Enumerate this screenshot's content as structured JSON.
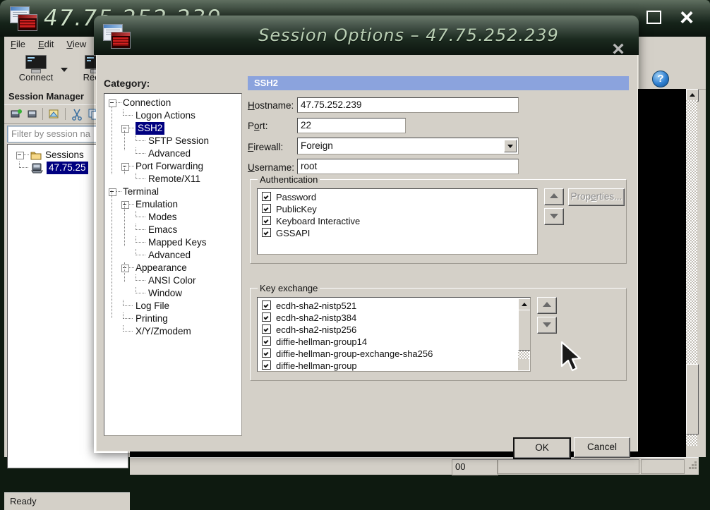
{
  "main_window": {
    "title": "47.75.252.239",
    "maximize_label": "□",
    "close_label": "×",
    "menu": [
      {
        "label": "File",
        "accel": "F"
      },
      {
        "label": "Edit",
        "accel": "E"
      },
      {
        "label": "View",
        "accel": "V"
      }
    ],
    "toolbar": {
      "connect_label": "Connect",
      "record_label": "Recor",
      "help_label": "Help",
      "help_glyph": "?"
    },
    "session_manager": {
      "title": "Session Manager",
      "filter_placeholder": "Filter by session na",
      "tree": {
        "root_label": "Sessions",
        "selected_session": "47.75.25"
      }
    },
    "status_bar": {
      "text": "Ready"
    },
    "bottom_strip": {
      "value": "00"
    }
  },
  "dialog": {
    "title": "Session Options – 47.75.252.239",
    "close_label": "×",
    "category_label": "Category:",
    "category_tree": [
      {
        "label": "Connection",
        "level": 0,
        "expander": true,
        "selected": false
      },
      {
        "label": "Logon Actions",
        "level": 1,
        "expander": false,
        "selected": false
      },
      {
        "label": "SSH2",
        "level": 1,
        "expander": true,
        "selected": true
      },
      {
        "label": "SFTP Session",
        "level": 2,
        "expander": false,
        "selected": false
      },
      {
        "label": "Advanced",
        "level": 2,
        "expander": false,
        "selected": false
      },
      {
        "label": "Port Forwarding",
        "level": 1,
        "expander": true,
        "selected": false
      },
      {
        "label": "Remote/X11",
        "level": 2,
        "expander": false,
        "selected": false
      },
      {
        "label": "Terminal",
        "level": 0,
        "expander": true,
        "selected": false
      },
      {
        "label": "Emulation",
        "level": 1,
        "expander": true,
        "selected": false
      },
      {
        "label": "Modes",
        "level": 2,
        "expander": false,
        "selected": false
      },
      {
        "label": "Emacs",
        "level": 2,
        "expander": false,
        "selected": false
      },
      {
        "label": "Mapped Keys",
        "level": 2,
        "expander": false,
        "selected": false
      },
      {
        "label": "Advanced",
        "level": 2,
        "expander": false,
        "selected": false
      },
      {
        "label": "Appearance",
        "level": 1,
        "expander": true,
        "selected": false
      },
      {
        "label": "ANSI Color",
        "level": 2,
        "expander": false,
        "selected": false
      },
      {
        "label": "Window",
        "level": 2,
        "expander": false,
        "selected": false
      },
      {
        "label": "Log File",
        "level": 1,
        "expander": false,
        "selected": false
      },
      {
        "label": "Printing",
        "level": 1,
        "expander": false,
        "selected": false
      },
      {
        "label": "X/Y/Zmodem",
        "level": 1,
        "expander": false,
        "selected": false
      }
    ],
    "panel": {
      "header": "SSH2",
      "fields": {
        "hostname": {
          "label_pre": "",
          "label_accel": "H",
          "label_post": "ostname:",
          "value": "47.75.252.239"
        },
        "port": {
          "label_pre": "P",
          "label_accel": "o",
          "label_post": "rt:",
          "value": "22"
        },
        "firewall": {
          "label_pre": "",
          "label_accel": "F",
          "label_post": "irewall:",
          "value": "Foreign"
        },
        "username": {
          "label_pre": "",
          "label_accel": "U",
          "label_post": "sername:",
          "value": "root"
        }
      },
      "authentication": {
        "title": "Authentication",
        "items": [
          {
            "label": "Password",
            "checked": true
          },
          {
            "label": "PublicKey",
            "checked": true
          },
          {
            "label": "Keyboard Interactive",
            "checked": true
          },
          {
            "label": "GSSAPI",
            "checked": true
          }
        ],
        "properties_button": {
          "pre": "Prop",
          "accel": "e",
          "post": "rties...",
          "enabled": false
        },
        "move_up_icon": "arrow-up-icon",
        "move_down_icon": "arrow-down-icon"
      },
      "key_exchange": {
        "title": "Key exchange",
        "items": [
          {
            "label": "ecdh-sha2-nistp521",
            "checked": true
          },
          {
            "label": "ecdh-sha2-nistp384",
            "checked": true
          },
          {
            "label": "ecdh-sha2-nistp256",
            "checked": true
          },
          {
            "label": "diffie-hellman-group14",
            "checked": true
          },
          {
            "label": "diffie-hellman-group-exchange-sha256",
            "checked": true
          },
          {
            "label": "diffie-hellman-group",
            "checked": true
          }
        ],
        "move_up_icon": "arrow-up-icon",
        "move_down_icon": "arrow-down-icon"
      }
    },
    "buttons": {
      "ok": "OK",
      "cancel": "Cancel"
    }
  },
  "colors": {
    "dialog_face": "#d4d0c8",
    "panel_header": "#8ba3dd",
    "selection": "#000080",
    "titlebar_dark": "#0c140e",
    "terminal_bg": "#000000"
  }
}
